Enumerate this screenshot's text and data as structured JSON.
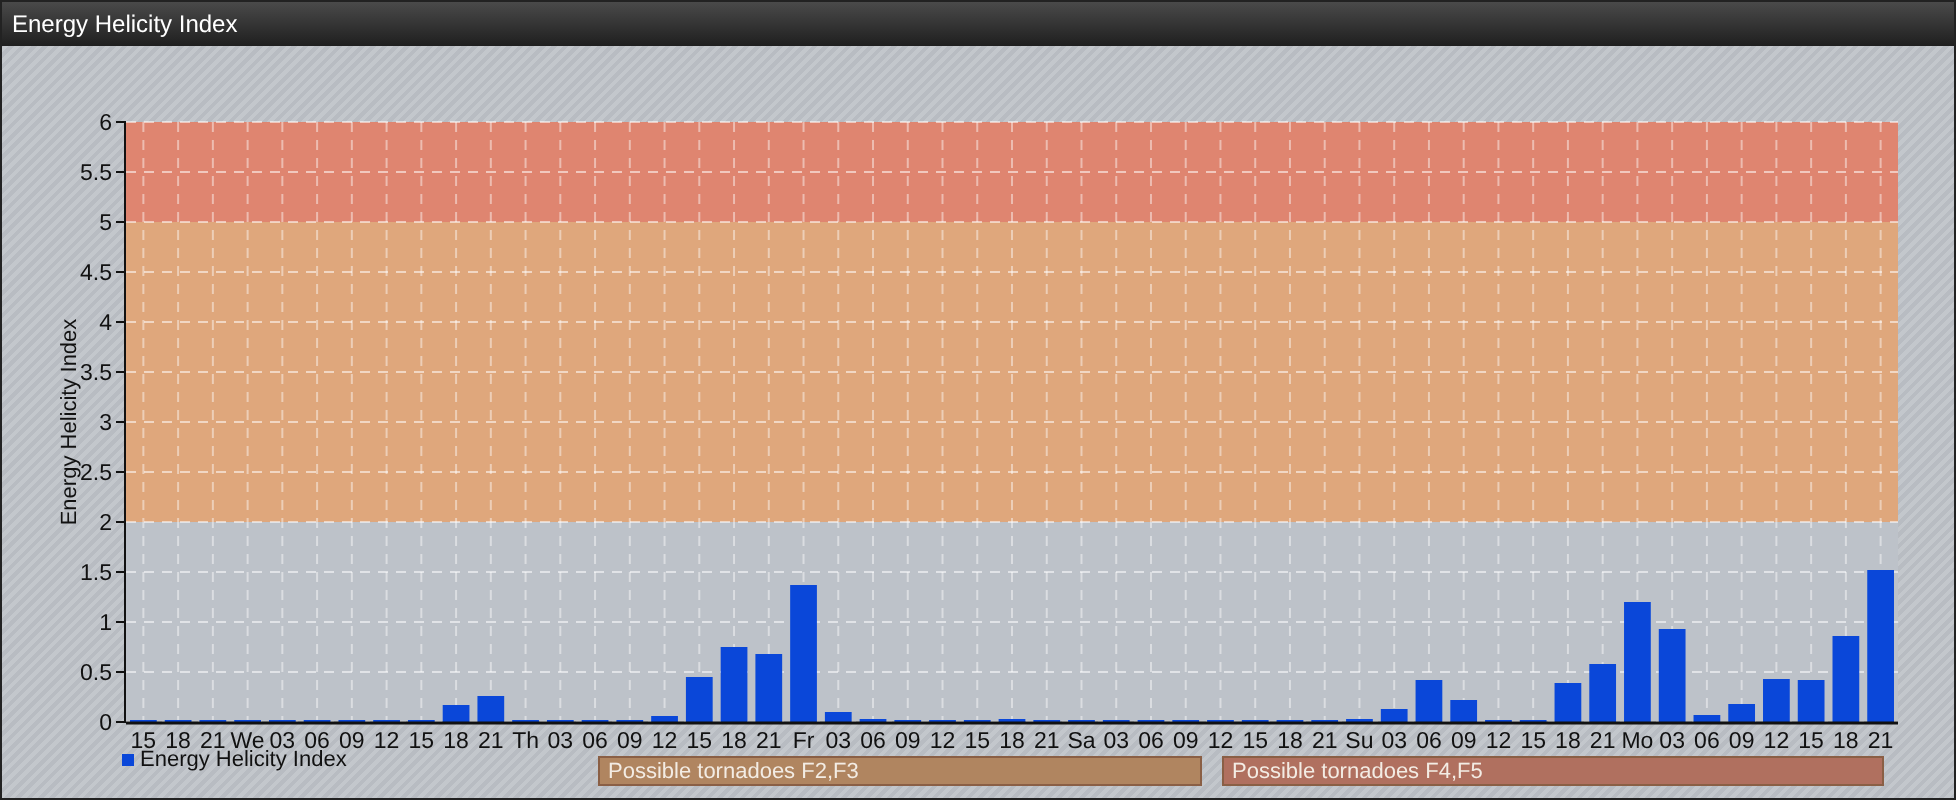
{
  "window": {
    "title": "Energy Helicity Index"
  },
  "chart": {
    "chart_data": {
      "type": "bar",
      "ylabel": "Energy Helicity Index",
      "categories": [
        "15",
        "18",
        "21",
        "We",
        "03",
        "06",
        "09",
        "12",
        "15",
        "18",
        "21",
        "Th",
        "03",
        "06",
        "09",
        "12",
        "15",
        "18",
        "21",
        "Fr",
        "03",
        "06",
        "09",
        "12",
        "15",
        "18",
        "21",
        "Sa",
        "03",
        "06",
        "09",
        "12",
        "15",
        "18",
        "21",
        "Su",
        "03",
        "06",
        "09",
        "12",
        "15",
        "18",
        "21",
        "Mo",
        "03",
        "06",
        "09",
        "12",
        "15",
        "18",
        "21"
      ],
      "series": [
        {
          "name": "Energy Helicity Index",
          "color": "#0a47d9",
          "values": [
            0.02,
            0.02,
            0.02,
            0.02,
            0.02,
            0.02,
            0.02,
            0.02,
            0.02,
            0.17,
            0.26,
            0.02,
            0.02,
            0.02,
            0.02,
            0.06,
            0.45,
            0.75,
            0.68,
            1.37,
            0.1,
            0.03,
            0.02,
            0.02,
            0.02,
            0.03,
            0.02,
            0.02,
            0.02,
            0.02,
            0.02,
            0.02,
            0.02,
            0.02,
            0.02,
            0.03,
            0.13,
            0.42,
            0.22,
            0.02,
            0.02,
            0.39,
            0.58,
            1.2,
            0.93,
            0.07,
            0.18,
            0.43,
            0.42,
            0.86,
            1.52
          ]
        }
      ],
      "ylim": [
        0,
        6
      ],
      "yticks": [
        0,
        0.5,
        1,
        1.5,
        2,
        2.5,
        3,
        3.5,
        4,
        4.5,
        5,
        5.5,
        6
      ],
      "grid": true,
      "bands": [
        {
          "axis": "y",
          "from": 0,
          "to": 2,
          "color": "#bdc2c9"
        },
        {
          "axis": "y",
          "from": 2,
          "to": 5,
          "color": "#dfa77c"
        },
        {
          "axis": "y",
          "from": 5,
          "to": 6,
          "color": "#df8570"
        }
      ]
    }
  },
  "zone_labels": [
    {
      "text": "Possible tornadoes F2,F3",
      "color": "#b08560"
    },
    {
      "text": "Possible tornadoes F4,F5",
      "color": "#b0705f"
    }
  ]
}
